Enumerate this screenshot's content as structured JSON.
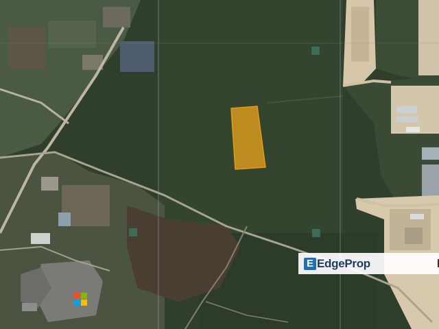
{
  "map": {
    "view": "satellite",
    "colors": {
      "forest": "#2f3f2c",
      "forest_light": "#3d5136",
      "plot_fill": "#f2a81a",
      "plot_stroke": "#e89b10",
      "road": "#b9b39e",
      "cleared_ground": "#d9c9ae",
      "grid_line": "#9aa3a6"
    },
    "highlighted_plot": {
      "label": "",
      "shape": "rectangle"
    }
  },
  "watermark": {
    "brand": "EdgeProp",
    "icon": "edgeprop-e-icon"
  },
  "imagery_logo": {
    "icon": "microsoft-logo-icon",
    "colors": [
      "#f25022",
      "#7fba00",
      "#00a4ef",
      "#ffb900"
    ]
  }
}
